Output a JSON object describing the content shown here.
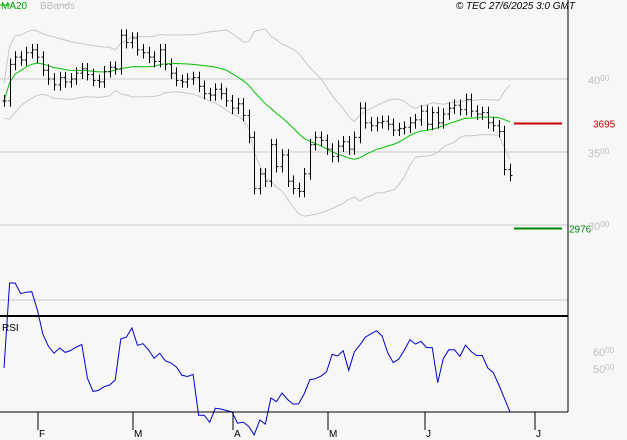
{
  "header": {
    "legend_ma": "MA20",
    "legend_bb": "BBands",
    "copyright": "© TEC 27/6/2025 3:0 GMT"
  },
  "colors": {
    "ma": "#00c000",
    "bands": "#c8c8c8",
    "bars": "#000000",
    "rsi": "#0000cc",
    "resistance": "#cc0000",
    "support": "#008800",
    "grid": "#c8c8c8"
  },
  "chart_data": [
    {
      "type": "ohlc",
      "title": "",
      "overlays": [
        "MA20",
        "BBands"
      ],
      "yticks": [
        {
          "value": 4000,
          "main": "40",
          "sub": "00"
        },
        {
          "value": 3500,
          "main": "35",
          "sub": "00"
        },
        {
          "value": 3000,
          "main": "30",
          "sub": "00"
        }
      ],
      "ylim": [
        2500,
        4530
      ],
      "xticks": [
        "F",
        "M",
        "A",
        "M",
        "J",
        "J"
      ],
      "closes": [
        3850,
        4100,
        4150,
        4130,
        4180,
        4200,
        4150,
        4060,
        4000,
        3960,
        4010,
        3980,
        4000,
        4040,
        4070,
        4030,
        3990,
        3980,
        4050,
        4080,
        4070,
        4300,
        4250,
        4280,
        4200,
        4180,
        4150,
        4120,
        4200,
        4100,
        4040,
        3990,
        3980,
        4000,
        4010,
        3950,
        3900,
        3890,
        3930,
        3900,
        3850,
        3800,
        3830,
        3750,
        3600,
        3250,
        3350,
        3300,
        3550,
        3400,
        3480,
        3300,
        3250,
        3230,
        3350,
        3550,
        3600,
        3580,
        3520,
        3470,
        3540,
        3570,
        3520,
        3600,
        3800,
        3700,
        3680,
        3700,
        3710,
        3690,
        3650,
        3660,
        3670,
        3700,
        3720,
        3780,
        3690,
        3770,
        3700,
        3760,
        3800,
        3820,
        3790,
        3860,
        3780,
        3760,
        3770,
        3700,
        3680,
        3640,
        3380,
        3340
      ],
      "levels": [
        {
          "name": "resistance",
          "value": 3695,
          "label": "3695"
        },
        {
          "name": "support",
          "value": 2976,
          "label": "2976"
        }
      ]
    },
    {
      "type": "line",
      "title": "RSI",
      "period": 14,
      "yticks": [
        {
          "value": 60,
          "main": "60",
          "sub": "00"
        },
        {
          "value": 50,
          "main": "50",
          "sub": "00"
        }
      ]
    }
  ]
}
